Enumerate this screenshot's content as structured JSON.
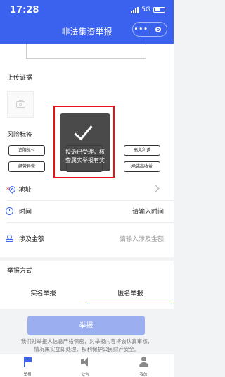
{
  "status_bar": {
    "time": "17:28",
    "network": "5G"
  },
  "header": {
    "title": "非法集资举报",
    "more_label": "•••"
  },
  "form": {
    "upload_label": "上传证据",
    "risk_label": "风险标签",
    "tags": [
      "追限兑付",
      "",
      "高息利诱",
      "经营异常",
      "",
      "承诺高收益"
    ],
    "address": {
      "star": "*",
      "label": "地址"
    },
    "time": {
      "label": "时间",
      "placeholder": "请输入时间"
    },
    "amount": {
      "label": "涉及金额",
      "placeholder": "请输入涉及金额"
    }
  },
  "report_method": {
    "label": "举报方式",
    "tabs": [
      "实名举报",
      "匿名举报"
    ],
    "selected": "匿名举报"
  },
  "submit_label": "举报",
  "notice": [
    "我们对举报人信息严格保密，对举报内容将会认真审核，",
    "情况属实立即处理，权利保护公民财产安全。"
  ],
  "toast": {
    "lines": [
      "投诉已受理，核",
      "查属实举报有奖"
    ]
  },
  "tabbar": {
    "items": [
      "举报",
      "公告",
      "我的"
    ],
    "active": "举报"
  },
  "colors": {
    "primary": "#3a62ef",
    "button_disabled": "#9aaef0",
    "highlight": "#e8101a",
    "required": "#e02020"
  }
}
